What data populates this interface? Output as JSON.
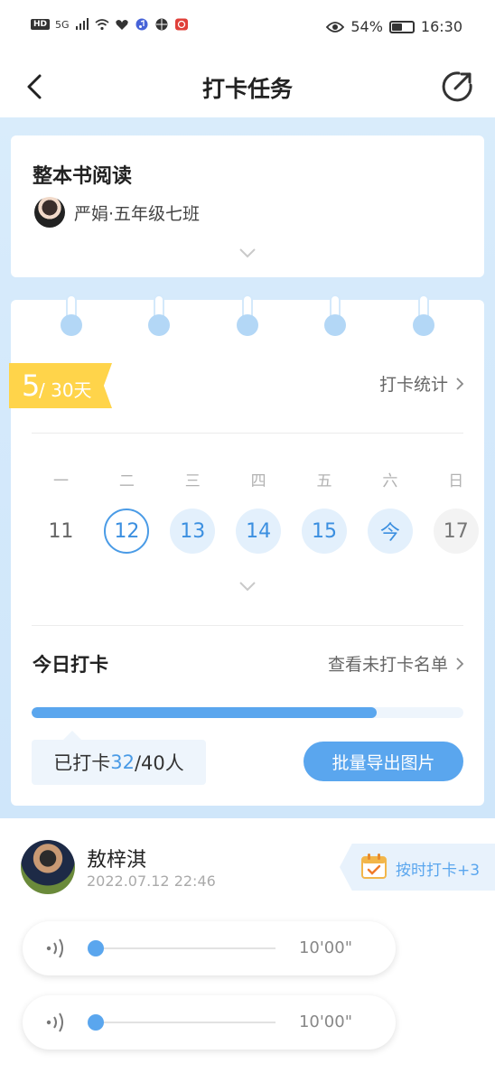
{
  "status_bar": {
    "network_badge": "HD",
    "signal_label": "5G",
    "eye_icon": "eye-icon",
    "battery_percent_text": "54%",
    "battery_level": 0.54,
    "time": "16:30"
  },
  "nav": {
    "title": "打卡任务",
    "back_icon": "chevron-left-icon",
    "share_icon": "share-icon"
  },
  "task": {
    "title": "整本书阅读",
    "teacher": "严娟·五年级七班"
  },
  "calendar": {
    "current_day": "5",
    "total_days": "/ 30天",
    "stats_link": "打卡统计",
    "weekdays": [
      "一",
      "二",
      "三",
      "四",
      "五",
      "六",
      "日"
    ],
    "dates": [
      "11",
      "12",
      "13",
      "14",
      "15",
      "今",
      "17"
    ],
    "date_states": [
      "plain",
      "selected",
      "done",
      "done",
      "done",
      "done",
      "future"
    ]
  },
  "today": {
    "title": "今日打卡",
    "unchecked_link": "查看未打卡名单",
    "progress": 0.8,
    "count_prefix": "已打卡",
    "checked": "32",
    "total": "/40人",
    "export_button": "批量导出图片"
  },
  "record": {
    "name": "敖梓淇",
    "time": "2022.07.12 22:46",
    "badge": "按时打卡+3",
    "audios": [
      {
        "duration": "10'00\"",
        "position": 0.0
      },
      {
        "duration": "10'00\"",
        "position": 0.0
      }
    ]
  },
  "colors": {
    "accent": "#5aa6ee",
    "badge_yellow": "#ffd44a",
    "backdrop": "#d4e9fb"
  }
}
